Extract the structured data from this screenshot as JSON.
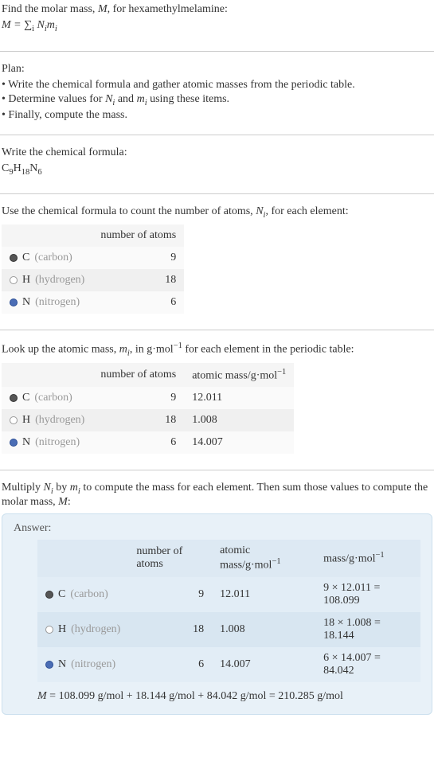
{
  "intro": {
    "line1_pre": "Find the molar mass, ",
    "line1_m": "M",
    "line1_post": ", for hexamethylmelamine:",
    "formula_html": "M = ∑",
    "formula_sub": "i",
    "formula_post": " N",
    "formula_post_sub": "i",
    "formula_m": "m",
    "formula_m_sub": "i"
  },
  "plan": {
    "heading": "Plan:",
    "items": [
      "• Write the chemical formula and gather atomic masses from the periodic table.",
      "• Determine values for Nᵢ and mᵢ using these items.",
      "• Finally, compute the mass."
    ]
  },
  "step_formula": {
    "heading": "Write the chemical formula:",
    "c": "C",
    "c_sub": "9",
    "h": "H",
    "h_sub": "18",
    "n": "N",
    "n_sub": "6"
  },
  "step_count": {
    "heading_pre": "Use the chemical formula to count the number of atoms, ",
    "heading_n": "N",
    "heading_n_sub": "i",
    "heading_post": ", for each element:",
    "table": {
      "header_atoms": "number of atoms",
      "rows": [
        {
          "symbol": "C",
          "name": "(carbon)",
          "count": "9",
          "dot": "dot-c"
        },
        {
          "symbol": "H",
          "name": "(hydrogen)",
          "count": "18",
          "dot": "dot-h"
        },
        {
          "symbol": "N",
          "name": "(nitrogen)",
          "count": "6",
          "dot": "dot-n"
        }
      ]
    }
  },
  "step_mass": {
    "heading_pre": "Look up the atomic mass, ",
    "heading_m": "m",
    "heading_m_sub": "i",
    "heading_mid": ", in g·mol",
    "heading_sup": "−1",
    "heading_post": " for each element in the periodic table:",
    "table": {
      "header_atoms": "number of atoms",
      "header_mass": "atomic mass/g·mol⁻¹",
      "rows": [
        {
          "symbol": "C",
          "name": "(carbon)",
          "count": "9",
          "mass": "12.011",
          "dot": "dot-c"
        },
        {
          "symbol": "H",
          "name": "(hydrogen)",
          "count": "18",
          "mass": "1.008",
          "dot": "dot-h"
        },
        {
          "symbol": "N",
          "name": "(nitrogen)",
          "count": "6",
          "mass": "14.007",
          "dot": "dot-n"
        }
      ]
    }
  },
  "step_compute": {
    "heading_pre": "Multiply ",
    "heading_n": "N",
    "heading_n_sub": "i",
    "heading_mid1": " by ",
    "heading_m": "m",
    "heading_m_sub": "i",
    "heading_mid2": " to compute the mass for each element. Then sum those values to compute the molar mass, ",
    "heading_M": "M",
    "heading_post": ":"
  },
  "answer": {
    "label": "Answer:",
    "table": {
      "header_atoms": "number of atoms",
      "header_mass": "atomic mass/g·mol⁻¹",
      "header_total": "mass/g·mol⁻¹",
      "rows": [
        {
          "symbol": "C",
          "name": "(carbon)",
          "count": "9",
          "mass": "12.011",
          "calc": "9 × 12.011 = 108.099",
          "dot": "dot-c"
        },
        {
          "symbol": "H",
          "name": "(hydrogen)",
          "count": "18",
          "mass": "1.008",
          "calc": "18 × 1.008 = 18.144",
          "dot": "dot-h"
        },
        {
          "symbol": "N",
          "name": "(nitrogen)",
          "count": "6",
          "mass": "14.007",
          "calc": "6 × 14.007 = 84.042",
          "dot": "dot-n"
        }
      ]
    },
    "final_m": "M",
    "final_eq": " = 108.099 g/mol + 18.144 g/mol + 84.042 g/mol = 210.285 g/mol"
  }
}
